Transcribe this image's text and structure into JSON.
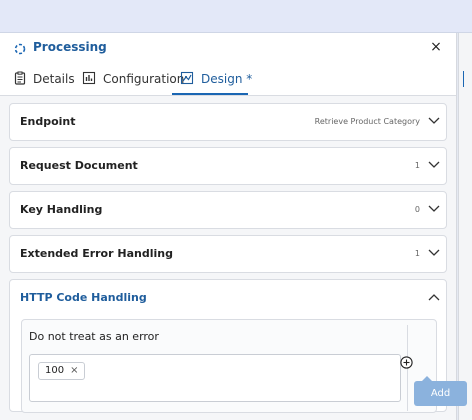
{
  "panel": {
    "title": "Processing",
    "close_symbol": "×"
  },
  "tabs": [
    {
      "label": "Details"
    },
    {
      "label": "Configuration"
    },
    {
      "label": "Design *"
    }
  ],
  "sections": [
    {
      "title": "Endpoint",
      "value": "Retrieve Product Category"
    },
    {
      "title": "Request Document",
      "value": "1"
    },
    {
      "title": "Key Handling",
      "value": "0"
    },
    {
      "title": "Extended Error Handling",
      "value": "1"
    },
    {
      "title": "HTTP Code Handling",
      "value": ""
    }
  ],
  "http_code_handling": {
    "label": "Do not treat as an error",
    "codes": [
      "100"
    ],
    "remove_symbol": "×",
    "add_tooltip": "Add"
  },
  "colors": {
    "accent": "#1f5d9c",
    "tooltip": "#8bb2dd",
    "topbar": "#e3e8f8"
  }
}
